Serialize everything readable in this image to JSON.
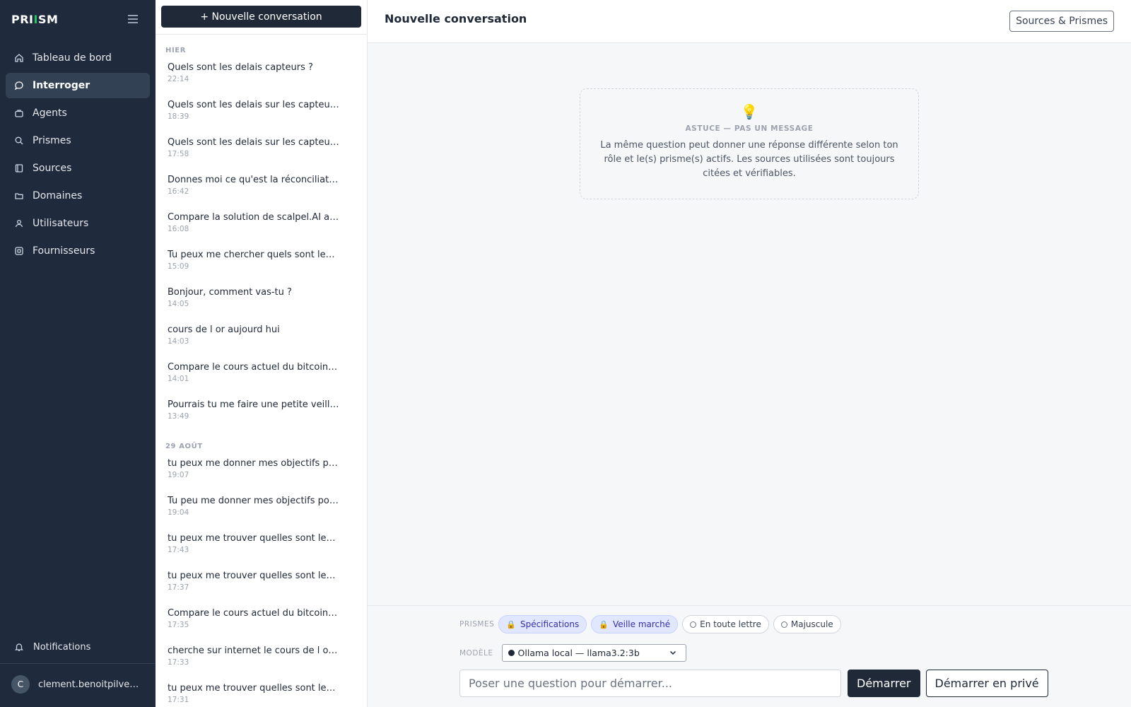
{
  "brand": {
    "pre": "PRI",
    "mid": "I",
    "post": "SM"
  },
  "nav": [
    {
      "label": "Tableau de bord",
      "icon": "home-icon",
      "active": false
    },
    {
      "label": "Interroger",
      "icon": "chat-bubble-icon",
      "active": true
    },
    {
      "label": "Agents",
      "icon": "briefcase-icon",
      "active": false
    },
    {
      "label": "Prismes",
      "icon": "search-icon",
      "active": false
    },
    {
      "label": "Sources",
      "icon": "book-icon",
      "active": false
    },
    {
      "label": "Domaines",
      "icon": "folder-icon",
      "active": false
    },
    {
      "label": "Utilisateurs",
      "icon": "user-icon",
      "active": false
    },
    {
      "label": "Fournisseurs",
      "icon": "provider-icon",
      "active": false
    }
  ],
  "notifications_label": "Notifications",
  "user": {
    "initial": "C",
    "email": "clement.benoitpilven@..."
  },
  "new_conversation_label": "+ Nouvelle conversation",
  "conversation_groups": [
    {
      "label": "HIER",
      "items": [
        {
          "title": "Quels sont les delais capteurs ?",
          "time": "22:14"
        },
        {
          "title": "Quels sont les delais sur les capteurs...",
          "time": "18:39"
        },
        {
          "title": "Quels sont les delais sur les capteurs...",
          "time": "17:58"
        },
        {
          "title": "Donnes moi ce qu'est la réconciliatio...",
          "time": "16:42"
        },
        {
          "title": "Compare la solution de scalpel.AI av...",
          "time": "16:08"
        },
        {
          "title": "Tu peux me chercher quels sont les ...",
          "time": "15:09"
        },
        {
          "title": "Bonjour, comment vas-tu ?",
          "time": "14:05"
        },
        {
          "title": "cours de l or aujourd hui",
          "time": "14:03"
        },
        {
          "title": "Compare le cours actuel du bitcoin e...",
          "time": "14:01"
        },
        {
          "title": "Pourrais tu me faire une petite veille...",
          "time": "13:49"
        }
      ]
    },
    {
      "label": "29 AOÛT",
      "items": [
        {
          "title": "tu peux me donner mes objectifs po...",
          "time": "19:07"
        },
        {
          "title": "Tu peu me donner mes objectifs pou...",
          "time": "19:04"
        },
        {
          "title": "tu peux me trouver quelles sont les ...",
          "time": "17:43"
        },
        {
          "title": "tu peux me trouver quelles sont les ...",
          "time": "17:37"
        },
        {
          "title": "Compare le cours actuel du bitcoin e...",
          "time": "17:35"
        },
        {
          "title": "cherche sur internet le cours de l or ...",
          "time": "17:33"
        },
        {
          "title": "tu peux me trouver quelles sont les ...",
          "time": "17:31"
        }
      ]
    }
  ],
  "header": {
    "title": "Nouvelle conversation",
    "sources_button": "Sources & Prismes"
  },
  "tip": {
    "icon": "lightbulb-icon",
    "heading": "ASTUCE — PAS UN MESSAGE",
    "text": "La même question peut donner une réponse différente selon ton rôle et le(s) prisme(s) actifs. Les sources utilisées sont toujours citées et vérifiables."
  },
  "composer": {
    "prisms_label": "PRISMES",
    "prisms": [
      {
        "label": "Spécifications",
        "locked": true
      },
      {
        "label": "Veille marché",
        "locked": true
      },
      {
        "label": "En toute lettre",
        "locked": false
      },
      {
        "label": "Majuscule",
        "locked": false
      }
    ],
    "model_label": "MODÈLE",
    "model_value": "Ollama local — llama3.2:3b",
    "question_placeholder": "Poser une question pour démarrer...",
    "start_label": "Démarrer",
    "private_label": "Démarrer en privé"
  },
  "colors": {
    "sidebar_bg": "#1f2a3d",
    "brand_accent": "#22c55e",
    "primary_button": "#1f2937",
    "locked_chip": "#e0e7ff"
  }
}
